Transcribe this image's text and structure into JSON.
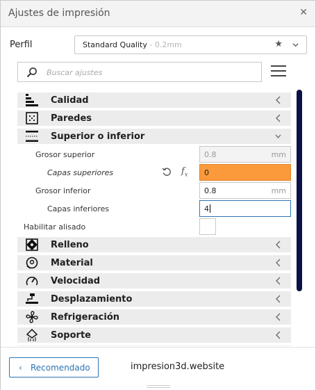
{
  "window": {
    "title": "Ajustes de impresión"
  },
  "profile": {
    "label": "Perfil",
    "name": "Standard Quality",
    "quality": " - 0.2mm"
  },
  "search": {
    "placeholder": "Buscar ajustes"
  },
  "categories": [
    {
      "label": "Calidad",
      "icon": "quality-icon"
    },
    {
      "label": "Paredes",
      "icon": "walls-icon"
    },
    {
      "label": "Superior o inferior",
      "icon": "top-bottom-icon",
      "expanded": true
    },
    {
      "label": "Relleno",
      "icon": "infill-icon"
    },
    {
      "label": "Material",
      "icon": "material-icon"
    },
    {
      "label": "Velocidad",
      "icon": "speed-icon"
    },
    {
      "label": "Desplazamiento",
      "icon": "travel-icon"
    },
    {
      "label": "Refrigeración",
      "icon": "cooling-icon"
    },
    {
      "label": "Soporte",
      "icon": "support-icon"
    }
  ],
  "settings": [
    {
      "label": "Grosor superior",
      "value": "0.8",
      "unit": "mm",
      "state": "disabled"
    },
    {
      "label": "Capas superiores",
      "value": "0",
      "state": "error"
    },
    {
      "label": "Grosor inferior",
      "value": "0.8",
      "unit": "mm",
      "state": "normal"
    },
    {
      "label": "Capas inferiores",
      "value": "4",
      "state": "focused"
    },
    {
      "label": "Habilitar alisado",
      "checked": false
    }
  ],
  "footer": {
    "recommended_label": "Recomendado",
    "watermark": "impresion3d.website"
  },
  "colors": {
    "accent": "#2c74b3",
    "error_field": "#fb9a3b",
    "scrollbar": "#0b1145",
    "category_bg": "#ececec"
  }
}
